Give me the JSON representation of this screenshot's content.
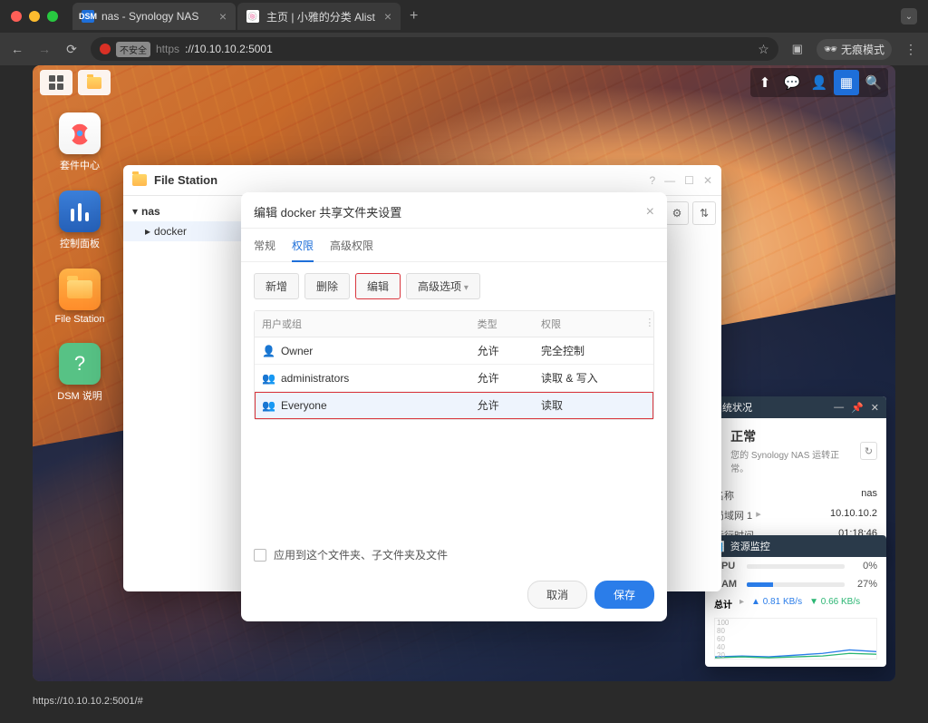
{
  "browser": {
    "tabs": [
      {
        "title": "nas - Synology NAS",
        "favicon_bg": "#1e6fd9",
        "favicon_text": "DSM",
        "active": true
      },
      {
        "title": "主页 | 小雅的分类 Alist",
        "favicon_bg": "#ffffff",
        "favicon_text": "🍥",
        "active": false
      }
    ],
    "url_insecure": "不安全",
    "url_scheme": "https",
    "url_host": "://10.10.10.2:5001",
    "incognito": "无痕模式"
  },
  "desktop": {
    "icons": [
      {
        "id": "pkg",
        "label": "套件中心"
      },
      {
        "id": "ctrl",
        "label": "控制面板"
      },
      {
        "id": "file",
        "label": "File Station"
      },
      {
        "id": "help",
        "label": "DSM 说明"
      }
    ]
  },
  "file_station": {
    "title": "File Station",
    "tree": {
      "root": "nas",
      "child": "docker"
    }
  },
  "modal": {
    "title": "编辑 docker 共享文件夹设置",
    "tabs": {
      "general": "常规",
      "perm": "权限",
      "adv": "高级权限"
    },
    "tools": {
      "add": "新增",
      "del": "删除",
      "edit": "编辑",
      "adv": "高级选项"
    },
    "cols": {
      "name": "用户或组",
      "type": "类型",
      "perm": "权限"
    },
    "rows": [
      {
        "name": "Owner",
        "type": "允许",
        "perm": "完全控制"
      },
      {
        "name": "administrators",
        "type": "允许",
        "perm": "读取 & 写入"
      },
      {
        "name": "Everyone",
        "type": "允许",
        "perm": "读取"
      }
    ],
    "apply": "应用到这个文件夹、子文件夹及文件",
    "cancel": "取消",
    "save": "保存"
  },
  "widget_sys": {
    "title": "系统状况",
    "ok": "正常",
    "ok_sub": "您的 Synology NAS 运转正常。",
    "rows": [
      {
        "k": "名称",
        "v": "nas"
      },
      {
        "k": "局域网 1",
        "v": "10.10.10.2",
        "caret": "▸"
      },
      {
        "k": "运行时间",
        "v": "01:18:46"
      }
    ]
  },
  "widget_res": {
    "title": "资源监控",
    "cpu": {
      "label": "CPU",
      "pct": 0
    },
    "ram": {
      "label": "RAM",
      "pct": 27
    },
    "total": "总计",
    "up": "0.81 KB/s",
    "down": "0.66 KB/s",
    "ticks": [
      "100",
      "80",
      "60",
      "40",
      "20"
    ]
  },
  "status_bar": "https://10.10.10.2:5001/#"
}
